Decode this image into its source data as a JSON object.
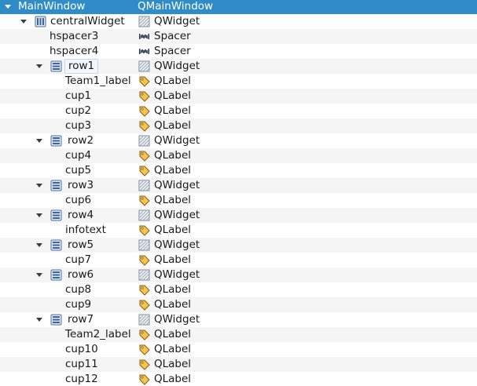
{
  "header": {
    "name": "MainWindow",
    "class": "QMainWindow"
  },
  "rows": [
    {
      "name": "centralWidget",
      "class": "QWidget",
      "depth": 1,
      "expandable": true,
      "layout_icon": "vertical-layout-icon",
      "class_icon": "widget-icon"
    },
    {
      "name": "hspacer3",
      "class": "Spacer",
      "depth": 2,
      "expandable": false,
      "layout_icon": "",
      "class_icon": "spacer-icon"
    },
    {
      "name": "hspacer4",
      "class": "Spacer",
      "depth": 2,
      "expandable": false,
      "layout_icon": "",
      "class_icon": "spacer-icon"
    },
    {
      "name": "row1",
      "class": "QWidget",
      "depth": 2,
      "expandable": true,
      "layout_icon": "form-layout-icon",
      "class_icon": "widget-icon",
      "boxed": true
    },
    {
      "name": "Team1_label",
      "class": "QLabel",
      "depth": 3,
      "expandable": false,
      "layout_icon": "",
      "class_icon": "label-icon"
    },
    {
      "name": "cup1",
      "class": "QLabel",
      "depth": 3,
      "expandable": false,
      "layout_icon": "",
      "class_icon": "label-icon"
    },
    {
      "name": "cup2",
      "class": "QLabel",
      "depth": 3,
      "expandable": false,
      "layout_icon": "",
      "class_icon": "label-icon"
    },
    {
      "name": "cup3",
      "class": "QLabel",
      "depth": 3,
      "expandable": false,
      "layout_icon": "",
      "class_icon": "label-icon"
    },
    {
      "name": "row2",
      "class": "QWidget",
      "depth": 2,
      "expandable": true,
      "layout_icon": "form-layout-icon",
      "class_icon": "widget-icon"
    },
    {
      "name": "cup4",
      "class": "QLabel",
      "depth": 3,
      "expandable": false,
      "layout_icon": "",
      "class_icon": "label-icon"
    },
    {
      "name": "cup5",
      "class": "QLabel",
      "depth": 3,
      "expandable": false,
      "layout_icon": "",
      "class_icon": "label-icon"
    },
    {
      "name": "row3",
      "class": "QWidget",
      "depth": 2,
      "expandable": true,
      "layout_icon": "form-layout-icon",
      "class_icon": "widget-icon"
    },
    {
      "name": "cup6",
      "class": "QLabel",
      "depth": 3,
      "expandable": false,
      "layout_icon": "",
      "class_icon": "label-icon"
    },
    {
      "name": "row4",
      "class": "QWidget",
      "depth": 2,
      "expandable": true,
      "layout_icon": "form-layout-icon",
      "class_icon": "widget-icon"
    },
    {
      "name": "infotext",
      "class": "QLabel",
      "depth": 3,
      "expandable": false,
      "layout_icon": "",
      "class_icon": "label-icon"
    },
    {
      "name": "row5",
      "class": "QWidget",
      "depth": 2,
      "expandable": true,
      "layout_icon": "form-layout-icon",
      "class_icon": "widget-icon"
    },
    {
      "name": "cup7",
      "class": "QLabel",
      "depth": 3,
      "expandable": false,
      "layout_icon": "",
      "class_icon": "label-icon"
    },
    {
      "name": "row6",
      "class": "QWidget",
      "depth": 2,
      "expandable": true,
      "layout_icon": "form-layout-icon",
      "class_icon": "widget-icon"
    },
    {
      "name": "cup8",
      "class": "QLabel",
      "depth": 3,
      "expandable": false,
      "layout_icon": "",
      "class_icon": "label-icon"
    },
    {
      "name": "cup9",
      "class": "QLabel",
      "depth": 3,
      "expandable": false,
      "layout_icon": "",
      "class_icon": "label-icon"
    },
    {
      "name": "row7",
      "class": "QWidget",
      "depth": 2,
      "expandable": true,
      "layout_icon": "form-layout-icon",
      "class_icon": "widget-icon"
    },
    {
      "name": "Team2_label",
      "class": "QLabel",
      "depth": 3,
      "expandable": false,
      "layout_icon": "",
      "class_icon": "label-icon"
    },
    {
      "name": "cup10",
      "class": "QLabel",
      "depth": 3,
      "expandable": false,
      "layout_icon": "",
      "class_icon": "label-icon"
    },
    {
      "name": "cup11",
      "class": "QLabel",
      "depth": 3,
      "expandable": false,
      "layout_icon": "",
      "class_icon": "label-icon"
    },
    {
      "name": "cup12",
      "class": "QLabel",
      "depth": 3,
      "expandable": false,
      "layout_icon": "",
      "class_icon": "label-icon"
    }
  ],
  "colors": {
    "header_bg": "#308cc6",
    "alt_row_bg": "#f5f5f5"
  }
}
